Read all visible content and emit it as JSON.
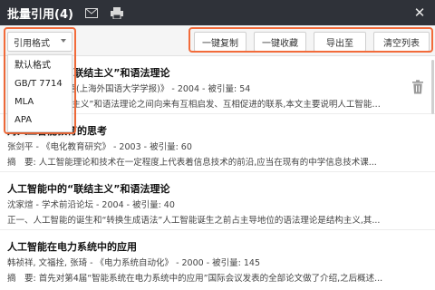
{
  "window": {
    "title": "批量引用(4)",
    "close_glyph": "✕"
  },
  "toolbar": {
    "format_select": "引用格式",
    "buttons": {
      "copy": "一键复制",
      "collect": "一键收藏",
      "export": "导出至",
      "clear": "清空列表"
    }
  },
  "dropdown": {
    "options": [
      "默认格式",
      "GB/T 7714",
      "MLA",
      "APA"
    ]
  },
  "entries": [
    {
      "title": "人工智能中的“联结主义”和语法理论",
      "meta": "沈家煊 - 《外国语(上海外国语大学学报)》 - 2004 - 被引量: 54",
      "abstract": "人工智能的“联结主义”和语法理论之间向来有互相启发、互相促进的联系,本文主要说明人工智能中..."
    },
    {
      "title": "对人工智能教育的思考",
      "meta": "张剑平 - 《电化教育研究》 - 2003 - 被引量: 60",
      "abstract": "摘　要: 人工智能理论和技术在一定程度上代表着信息技术的前沿,应当在现有的中学信息技术课..."
    },
    {
      "title": "人工智能中的“联结主义”和语法理论",
      "meta": "沈家煊 - 学术前沿论坛 - 2004 - 被引量: 40",
      "abstract": "正一、人工智能的诞生和“转换生成语法”人工智能诞生之前占主导地位的语法理论是结构主义,其..."
    },
    {
      "title": "人工智能在电力系统中的应用",
      "meta": "韩祯祥, 文福拴, 张琦 - 《电力系统自动化》 - 2000 - 被引量: 145",
      "abstract": "摘　要: 首先对第4届“智能系统在电力系统中的应用”国际会议发表的全部论文做了介绍,之后概述..."
    }
  ],
  "colors": {
    "titlebar": "#2f3239",
    "highlight": "#f26b3a"
  },
  "icons": {
    "mail": "mail-icon",
    "print": "print-icon",
    "trash": "trash-icon"
  }
}
